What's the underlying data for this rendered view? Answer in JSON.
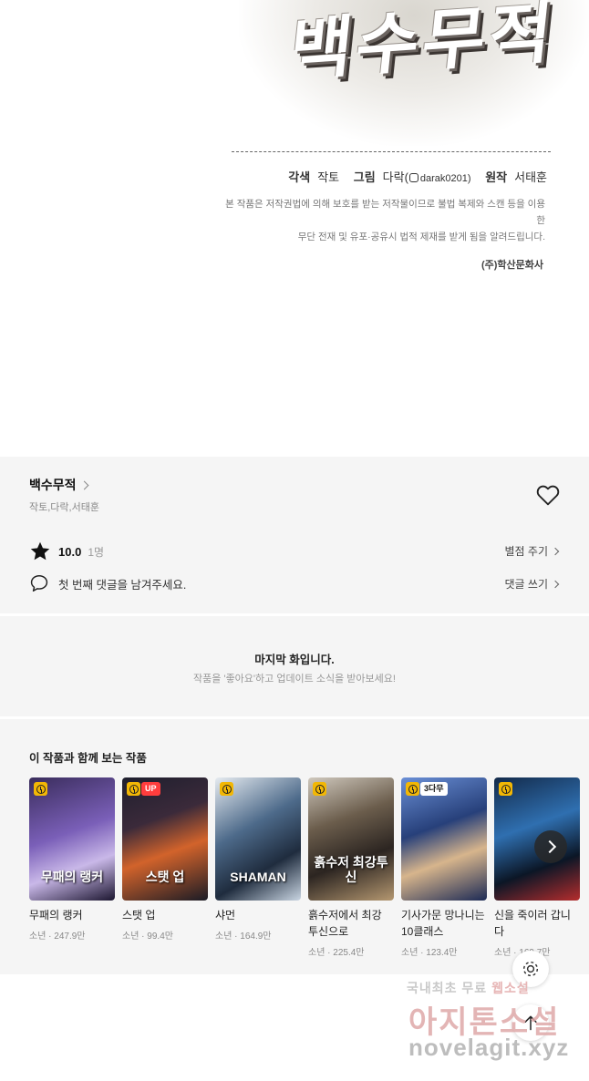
{
  "comic": {
    "logo_text": "백수무적",
    "credits": {
      "adapt_label": "각색",
      "adapt_name": "작토",
      "art_label": "그림",
      "art_name": "다락(",
      "art_handle": "darak0201)",
      "orig_label": "원작",
      "orig_name": "서태훈"
    },
    "notice_line1": "본 작품은 저작권법에 의해 보호를 받는 저작물이므로 불법 복제와 스캔 등을 이용한",
    "notice_line2": "무단 전재 및 유포·공유시 법적 제재를 받게 됨을 알려드립니다.",
    "publisher": "(주)학산문화사"
  },
  "info": {
    "title": "백수무적",
    "authors": "작토,다락,서태훈",
    "score": "10.0",
    "rating_count": "1명",
    "rate_action": "별점 주기",
    "comment_prompt": "첫 번째 댓글을 남겨주세요.",
    "comment_action": "댓글 쓰기"
  },
  "last_episode": {
    "title": "마지막 화입니다.",
    "subtitle": "작품을 '좋아요'하고 업데이트 소식을 받아보세요!"
  },
  "recommendations": {
    "title": "이 작품과 함께 보는 작품",
    "items": [
      {
        "title": "무패의 랭커",
        "meta": "소년 · 247.9만",
        "badge": "",
        "art": "linear-gradient(160deg,#3a2d5c 0%,#7a5fb8 45%,#c9b8e8 70%,#1c1630 100%)",
        "art_text": "무패의 랭커"
      },
      {
        "title": "스탯 업",
        "meta": "소년 · 99.4만",
        "badge": "UP",
        "art": "linear-gradient(160deg,#1e1f2e 0%,#3b2a3a 35%,#d2632b 60%,#1b1b25 100%)",
        "art_text": "스탯 업"
      },
      {
        "title": "샤먼",
        "meta": "소년 · 164.9만",
        "badge": "",
        "art": "linear-gradient(150deg,#e6ebf0 0%,#4d6a8a 40%,#1f2c3e 70%,#c9d5e2 100%)",
        "art_text": "SHAMAN"
      },
      {
        "title": "흙수저에서 최강 투신으로",
        "meta": "소년 · 225.4만",
        "badge": "",
        "art": "linear-gradient(160deg,#cfc8bd 0%,#6b5d4c 35%,#2c2521 65%,#b49770 100%)",
        "art_text": "흙수저 최강투신"
      },
      {
        "title": "기사가문 망나니는 10클래스",
        "meta": "소년 · 123.4만",
        "badge": "3다무",
        "art": "linear-gradient(160deg,#6a8fd6 0%,#27407a 40%,#d7b58c 65%,#1c2a55 100%)",
        "art_text": ""
      },
      {
        "title": "신을 죽이러 갑니다",
        "meta": "소년 · 169.7만",
        "badge": "",
        "art": "linear-gradient(160deg,#132a4a 0%,#2f6fb0 40%,#0b1626 70%,#b52d2d 100%)",
        "art_text": ""
      }
    ]
  },
  "watermark": {
    "line1_a": "국내최초 무료 ",
    "line1_b": "웹소설",
    "line2": "아지톤소설",
    "line3": "novelagit.xyz"
  },
  "icons": {
    "heart": "heart-outline-icon",
    "star": "star-filled-icon",
    "comment": "speech-bubble-icon",
    "gear": "gear-icon",
    "to_top": "arrow-up-icon",
    "next": "chevron-right-icon"
  },
  "colors": {
    "panel_bg": "#f5f5f5",
    "badge_clock": "#f2b705",
    "badge_up": "#ff3d3d"
  }
}
